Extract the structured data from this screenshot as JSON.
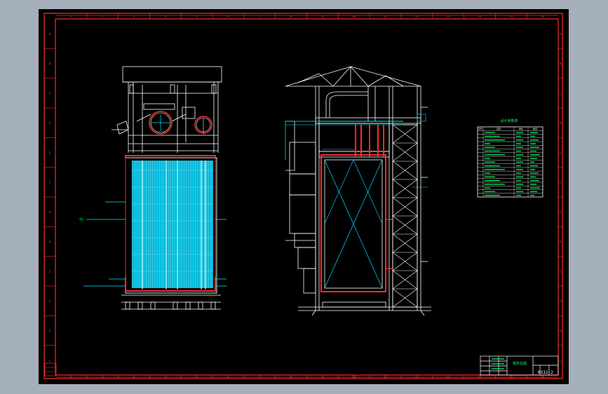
{
  "colors": {
    "background": "#a6b0bd",
    "sheet": "#000000",
    "frame": "#ff2a2a",
    "structure": "#ffffff",
    "tubes": "#00e5ff",
    "labels": "#00ff66"
  },
  "grid": {
    "top_numbers": [
      "1",
      "2",
      "3",
      "4",
      "5",
      "6",
      "7",
      "8",
      "9",
      "10",
      "11",
      "12",
      "13",
      "14",
      "15",
      "16"
    ],
    "bottom_numbers": [
      "1",
      "2",
      "3",
      "4",
      "5",
      "6",
      "7",
      "8",
      "9",
      "10",
      "11",
      "12",
      "13",
      "14",
      "15",
      "16"
    ],
    "side_letters": [
      "A",
      "B",
      "C",
      "D",
      "E",
      "F",
      "G",
      "H",
      "I",
      "J",
      "K",
      "L"
    ]
  },
  "notes": {
    "front_view_tag": "TS",
    "table_title": "设计参数表",
    "title_block_name": "锅炉总图",
    "drawing_number": "KS12-2"
  },
  "param_table": {
    "header": [
      "序号",
      "名称",
      "单位",
      "数值"
    ],
    "row_count": 18
  }
}
